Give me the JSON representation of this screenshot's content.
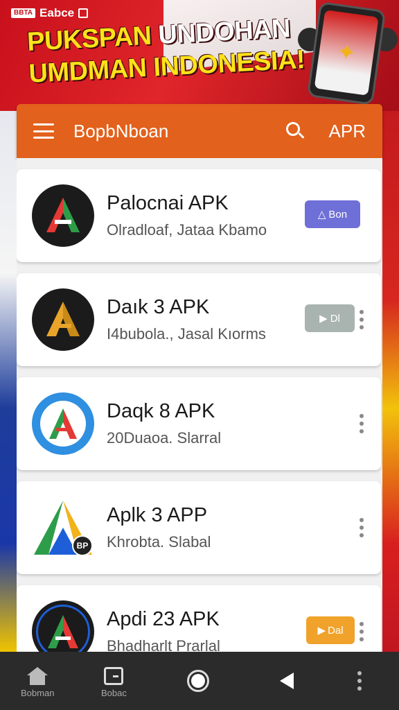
{
  "status_bar": {
    "chip": "BBTA",
    "label": "Eabce"
  },
  "banner": {
    "headline_line1_yellow": "PUKSPAN ",
    "headline_line1_white": "UNDOHAN",
    "headline_line2": "UMDMAN INDONESIA!"
  },
  "header": {
    "title": "BopbNboan",
    "action": "APR",
    "accent_color": "#e2611c"
  },
  "apps": [
    {
      "name": "Palocnai APK",
      "description": "Olradloaf, Jataa Kbamo",
      "icon": "red-green-a-icon",
      "button_label": "Bon",
      "button_color": "#6f6fd8",
      "has_menu": false
    },
    {
      "name": "Daık 3 APK",
      "description": "I4bubola., Jasal Kıorms",
      "icon": "gold-a-icon",
      "button_label": "Dl",
      "button_color": "#a9b3b0",
      "has_menu": true
    },
    {
      "name": "Daqk 8 APK",
      "description": "20Duaoa. Slarral",
      "icon": "blue-ring-a-icon",
      "has_menu": true
    },
    {
      "name": "Aplk 3 APP",
      "description": "Khrobta. Slabal",
      "icon": "tricolor-a-icon",
      "badge": "BP",
      "has_menu": true
    },
    {
      "name": "Apdi 23 APK",
      "description": "Bhadharlt Prarlal",
      "icon": "dark-red-green-a-icon",
      "button_label": "Dal",
      "button_color": "#f0a22a",
      "has_menu": true
    }
  ],
  "bottom_nav": {
    "home_label": "Bobman",
    "recents_label": "Bobac"
  }
}
